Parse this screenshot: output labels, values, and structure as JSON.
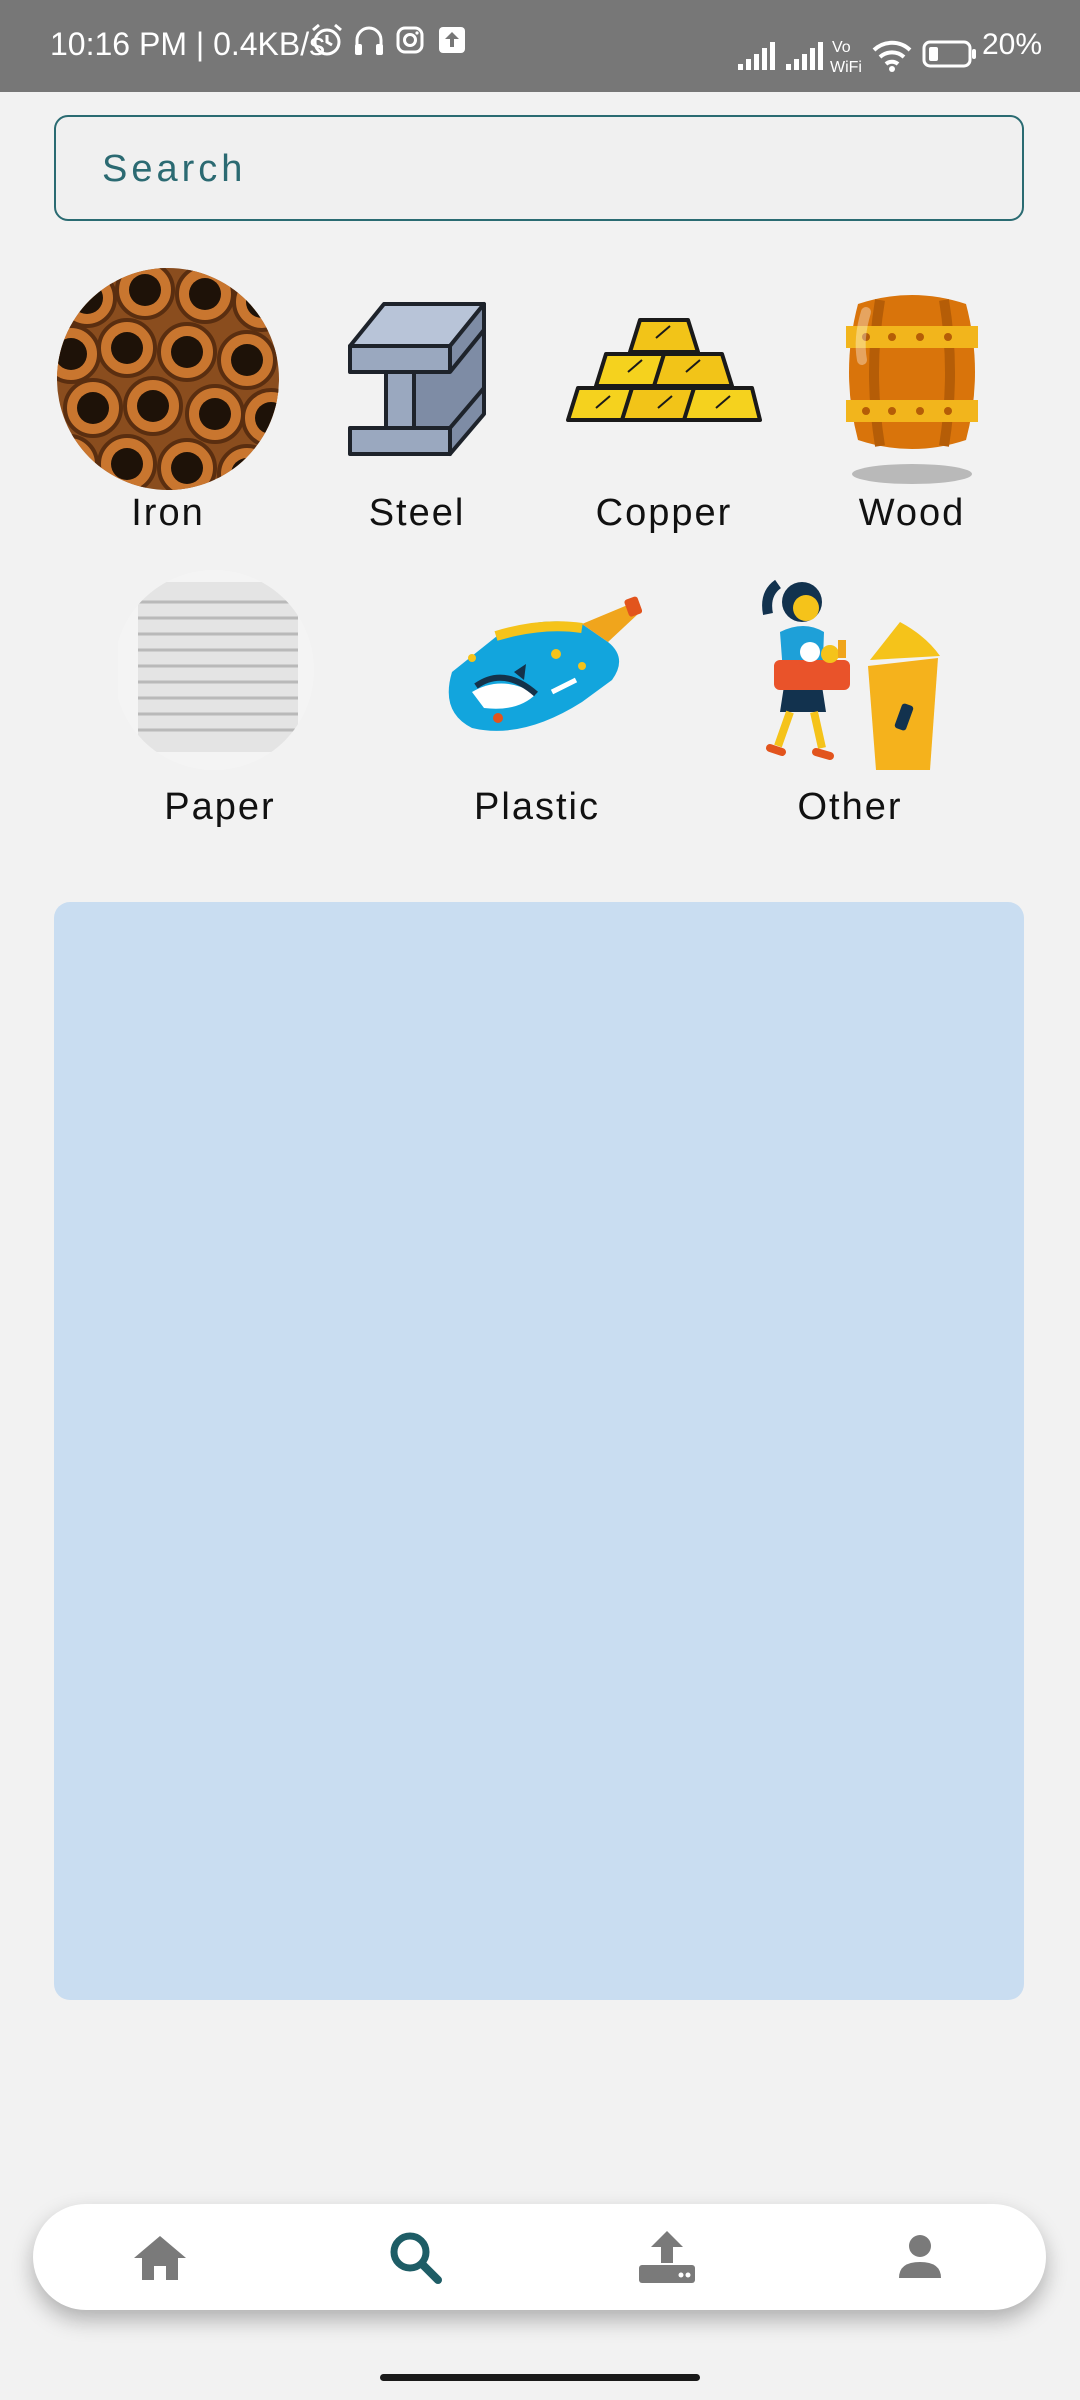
{
  "status_bar": {
    "time_info": "10:16 PM | 0.4KB/s",
    "battery": "20%",
    "icons": [
      "alarm-icon",
      "headphones-icon",
      "instagram-icon",
      "upload-notification-icon",
      "signal-icon",
      "signal-icon",
      "vowifi-icon",
      "wifi-icon",
      "battery-icon"
    ]
  },
  "search": {
    "placeholder": "Search",
    "value": ""
  },
  "categories": [
    {
      "label": "Iron",
      "icon": "rusty-pipes-image"
    },
    {
      "label": "Steel",
      "icon": "steel-beam-image"
    },
    {
      "label": "Copper",
      "icon": "gold-bars-image"
    },
    {
      "label": "Wood",
      "icon": "wooden-barrel-image"
    },
    {
      "label": "Paper",
      "icon": "paper-stack-image"
    },
    {
      "label": "Plastic",
      "icon": "plastic-bottle-image"
    },
    {
      "label": "Other",
      "icon": "recycling-woman-image"
    }
  ],
  "bottom_nav": {
    "items": [
      "home-icon",
      "search-icon",
      "upload-icon",
      "profile-icon"
    ],
    "active": "search-icon"
  },
  "colors": {
    "accent": "#1e5d66",
    "panel": "#c9ddf1",
    "status_bar": "#777777",
    "nav_inactive": "#7a7a7a"
  }
}
